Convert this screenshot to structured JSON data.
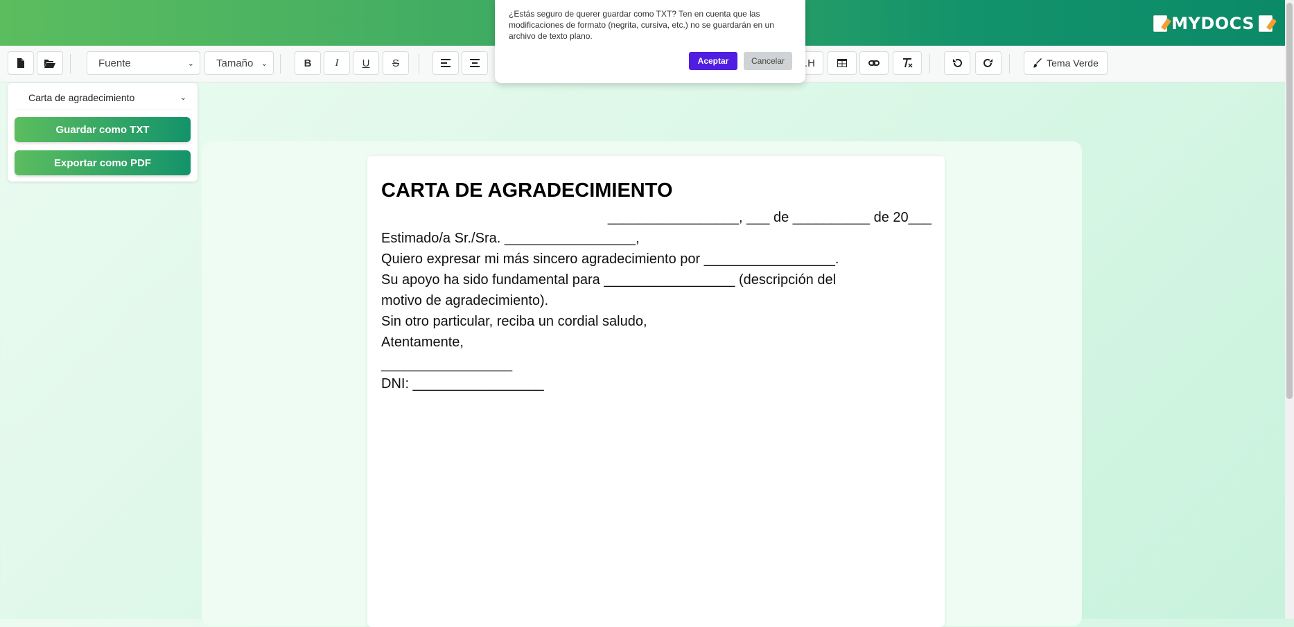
{
  "header": {
    "logo": "MYDOCS"
  },
  "toolbar": {
    "font_placeholder": "Fuente",
    "size_placeholder": "Tamaño",
    "bold": "B",
    "italic": "I",
    "underline": "U",
    "strike": "S",
    "line_height_partial": ".H",
    "theme_label": "Tema Verde"
  },
  "sidebar": {
    "template_select": "Carta de agradecimiento",
    "save_txt": "Guardar como TXT",
    "export_pdf": "Exportar como PDF"
  },
  "dialog": {
    "message": "¿Estás seguro de querer guardar como TXT? Ten en cuenta que las modificaciones de formato (negrita, cursiva, etc.) no se guardarán en un archivo de texto plano.",
    "accept": "Aceptar",
    "cancel": "Cancelar"
  },
  "document": {
    "title": "CARTA DE AGRADECIMIENTO",
    "date_line": "_________________, ___ de __________ de 20___",
    "greeting": "Estimado/a Sr./Sra. _________________,",
    "line1": "Quiero expresar mi más sincero agradecimiento por _________________.",
    "line2": "Su apoyo ha sido fundamental para _________________ (descripción del",
    "line3": "motivo de agradecimiento).",
    "line4": "Sin otro particular, reciba un cordial saludo,",
    "closing": "Atentamente,",
    "signature": "_________________",
    "dni": "DNI: _________________"
  },
  "colors": {
    "header_start": "#5cbd5f",
    "header_end": "#0b8a68",
    "accept_button": "#4f1ee0",
    "cancel_button": "#cfd3d6"
  }
}
